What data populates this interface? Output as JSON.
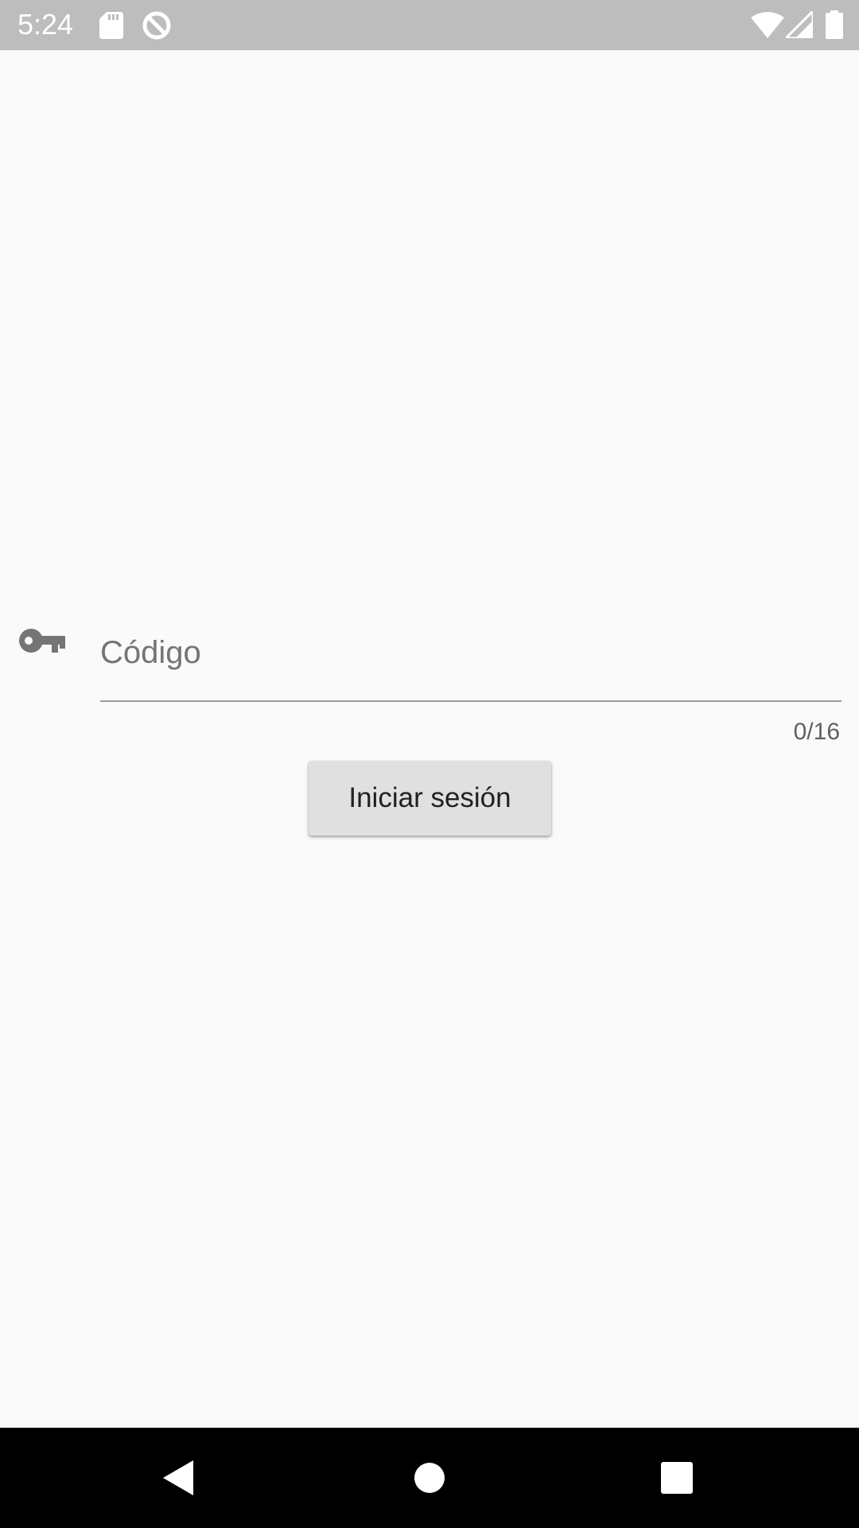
{
  "status_bar": {
    "time": "5:24",
    "icons": [
      "sd-card-icon",
      "data-saver-icon",
      "wifi-icon",
      "signal-icon",
      "battery-icon"
    ]
  },
  "login": {
    "code_field": {
      "placeholder": "Código",
      "value": "",
      "counter": "0/16"
    },
    "login_button_label": "Iniciar sesión",
    "key_icon": "key-icon"
  },
  "nav_bar": {
    "buttons": [
      "back-icon",
      "home-icon",
      "recents-icon"
    ]
  },
  "colors": {
    "status_bar_bg": "#bdbdbd",
    "page_bg": "#fafafa",
    "button_bg": "#e0e0e0",
    "icon_gray": "#757575",
    "nav_bar_bg": "#000000"
  }
}
